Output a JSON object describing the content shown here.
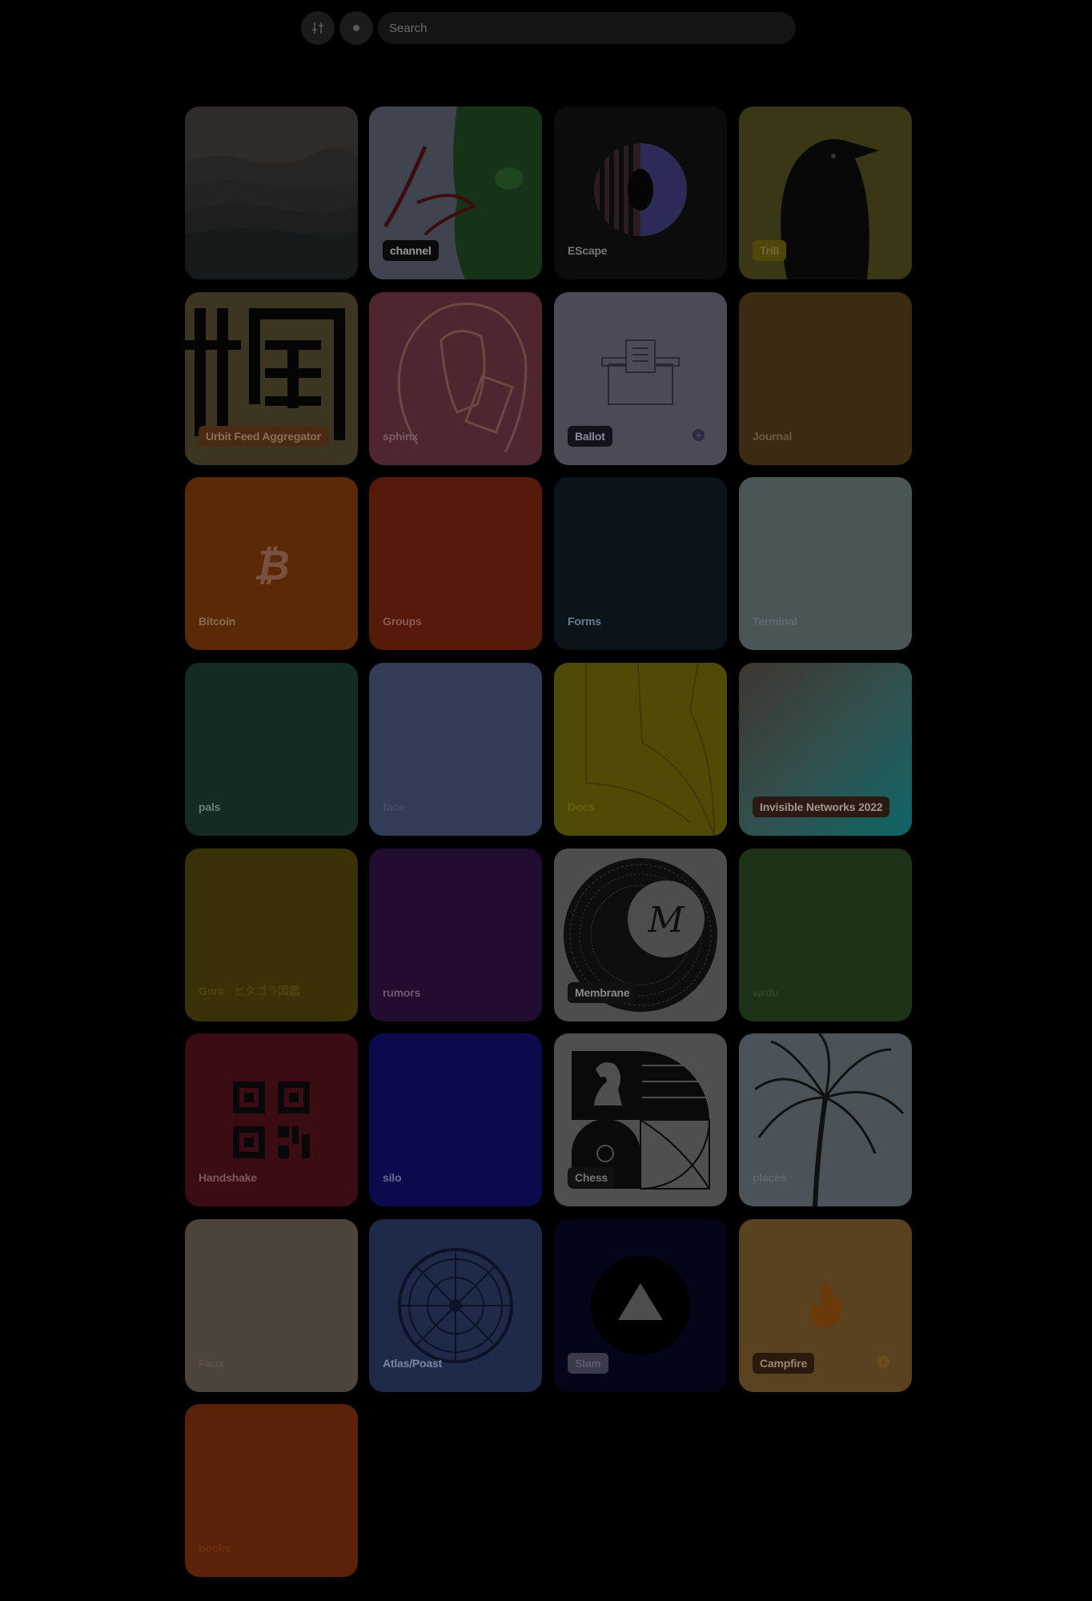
{
  "search": {
    "placeholder": "Search",
    "value": ""
  },
  "toolbar": {
    "filter_icon": "sliders-icon",
    "dot_icon": "dot-icon"
  },
  "tiles": [
    {
      "label": "",
      "bg": "#2b2a27"
    },
    {
      "label": "channel",
      "bg": "#3f4450"
    },
    {
      "label": "EScape",
      "bg": "#0c0c0c"
    },
    {
      "label": "Trill",
      "bg": "#3a3716"
    },
    {
      "label": "Urbit Feed Aggregator",
      "bg": "#3c3522"
    },
    {
      "label": "sphinx",
      "bg": "#4f2530"
    },
    {
      "label": "Ballot",
      "bg": "#4c4a57"
    },
    {
      "label": "Journal",
      "bg": "#3b2b12"
    },
    {
      "label": "Bitcoin",
      "bg": "#5a2a06"
    },
    {
      "label": "Groups",
      "bg": "#551a0a"
    },
    {
      "label": "Forms",
      "bg": "#0b141b"
    },
    {
      "label": "Terminal",
      "bg": "#4a5558"
    },
    {
      "label": "pals",
      "bg": "#142b22"
    },
    {
      "label": "face",
      "bg": "#323c56"
    },
    {
      "label": "Docs",
      "bg": "#4f4a06"
    },
    {
      "label": "Invisible Networks 2022",
      "bg": "#2f4a4a"
    },
    {
      "label": "Gora - ヒタゴラ図鑑",
      "bg": "#3a3106"
    },
    {
      "label": "rumors",
      "bg": "#220c30"
    },
    {
      "label": "Membrane",
      "bg": "#4d4d4d"
    },
    {
      "label": "wrdu",
      "bg": "#1e3217"
    },
    {
      "label": "Handshake",
      "bg": "#3b0d12"
    },
    {
      "label": "silo",
      "bg": "#0a0a4d"
    },
    {
      "label": "Chess",
      "bg": "#4f4f4f"
    },
    {
      "label": "places",
      "bg": "#4a5358"
    },
    {
      "label": "Faux",
      "bg": "#4c433a"
    },
    {
      "label": "Atlas/Poast",
      "bg": "#1e2a48"
    },
    {
      "label": "Slam",
      "bg": "#05051a"
    },
    {
      "label": "Campfire",
      "bg": "#5a4120"
    },
    {
      "label": "books",
      "bg": "#5a2208"
    }
  ]
}
